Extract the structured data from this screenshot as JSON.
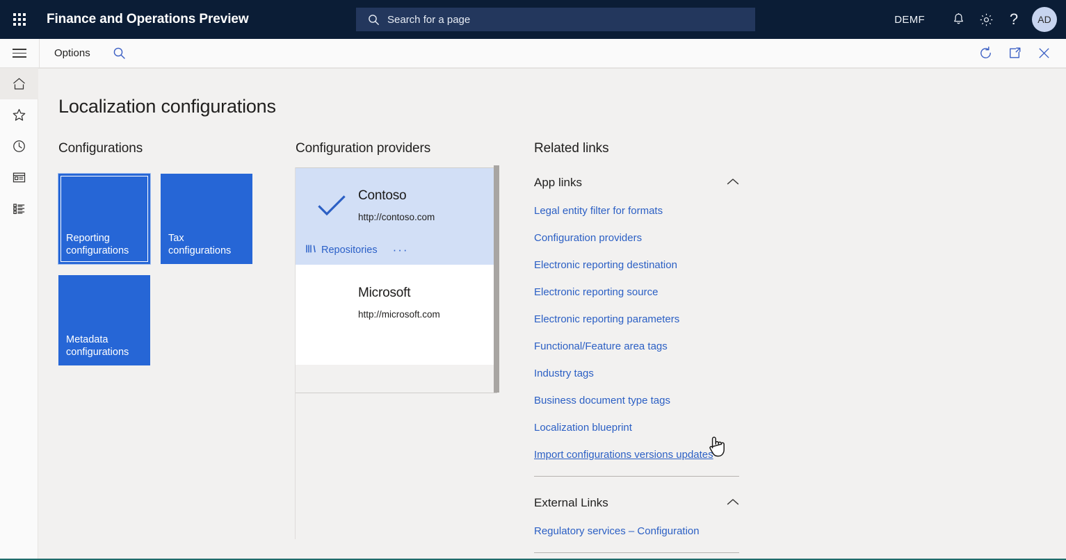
{
  "topbar": {
    "waffle_icon": "app-launcher-icon",
    "app_title": "Finance and Operations Preview",
    "search": {
      "placeholder": "Search for a page",
      "value": "",
      "icon": "search-icon"
    },
    "company": "DEMF",
    "notifications_icon": "bell-icon",
    "settings_icon": "gear-icon",
    "help_icon": "question-mark-icon",
    "avatar_initials": "AD",
    "bg_color": "#0b1d36",
    "search_bg_color": "#23375d",
    "avatar_bg_color": "#c7d4ef"
  },
  "toolbar": {
    "menu_icon": "hamburger-icon",
    "options_label": "Options",
    "search_icon": "search-icon",
    "refresh_icon": "refresh-icon",
    "popout_icon": "open-in-new-window-icon",
    "close_icon": "close-icon",
    "accent_color": "#2b5fc4"
  },
  "rail": {
    "items": [
      {
        "name": "home",
        "icon": "home-icon",
        "active": true
      },
      {
        "name": "favorites",
        "icon": "star-icon",
        "active": false
      },
      {
        "name": "recent",
        "icon": "clock-icon",
        "active": false
      },
      {
        "name": "workspaces",
        "icon": "workspace-window-icon",
        "active": false
      },
      {
        "name": "modules",
        "icon": "list-icon",
        "active": false
      }
    ]
  },
  "page": {
    "title": "Localization configurations"
  },
  "configurations": {
    "heading": "Configurations",
    "tile_color": "#2666d6",
    "tiles": [
      {
        "label": "Reporting configurations",
        "selected": true
      },
      {
        "label": "Tax configurations",
        "selected": false
      },
      {
        "label": "Metadata configurations",
        "selected": false
      }
    ]
  },
  "providers": {
    "heading": "Configuration providers",
    "selected_bg_color": "#d2dff6",
    "items": [
      {
        "name": "Contoso",
        "url": "http://contoso.com",
        "selected": true,
        "check_icon": "checkmark-icon",
        "repositories_label": "Repositories",
        "repositories_icon": "books-icon",
        "overflow_label": "···"
      },
      {
        "name": "Microsoft",
        "url": "http://microsoft.com",
        "selected": false
      }
    ]
  },
  "related": {
    "heading": "Related links",
    "groups": [
      {
        "title": "App links",
        "expanded": true,
        "chevron_icon": "chevron-up-icon",
        "links": [
          {
            "label": "Legal entity filter for formats",
            "hovered": false
          },
          {
            "label": "Configuration providers",
            "hovered": false
          },
          {
            "label": "Electronic reporting destination",
            "hovered": false
          },
          {
            "label": "Electronic reporting source",
            "hovered": false
          },
          {
            "label": "Electronic reporting parameters",
            "hovered": false
          },
          {
            "label": "Functional/Feature area tags",
            "hovered": false
          },
          {
            "label": "Industry tags",
            "hovered": false
          },
          {
            "label": "Business document type tags",
            "hovered": false
          },
          {
            "label": "Localization blueprint",
            "hovered": false
          },
          {
            "label": "Import configurations versions updates",
            "hovered": true
          }
        ]
      },
      {
        "title": "External Links",
        "expanded": true,
        "chevron_icon": "chevron-up-icon",
        "links": [
          {
            "label": "Regulatory services – Configuration",
            "hovered": false
          }
        ]
      }
    ],
    "link_color": "#2b5fc4"
  },
  "cursor": {
    "type": "pointer-hand-cursor"
  }
}
